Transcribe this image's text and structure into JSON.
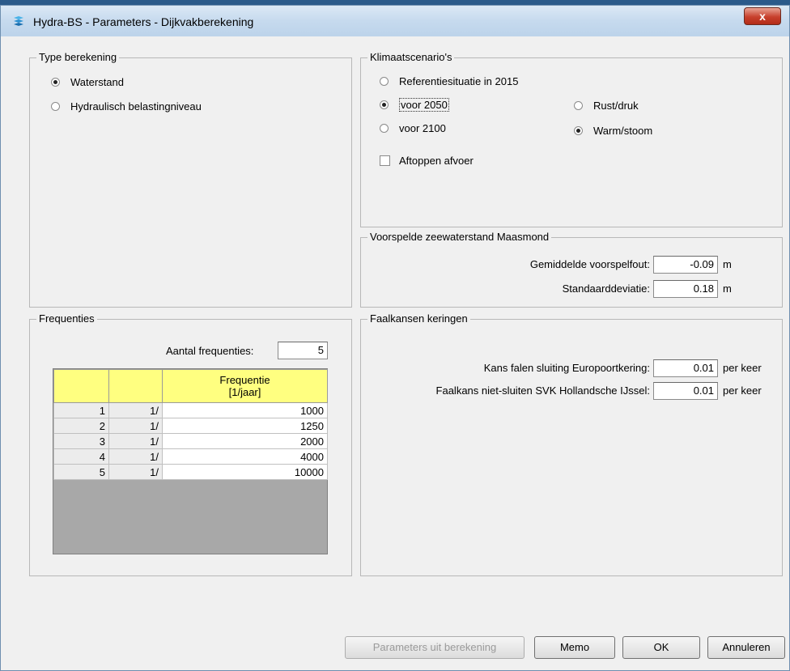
{
  "window": {
    "title": "Hydra-BS - Parameters - Dijkvakberekening",
    "close_label": "x"
  },
  "type_berekening": {
    "title": "Type berekening",
    "options": [
      {
        "label": "Waterstand",
        "checked": true
      },
      {
        "label": "Hydraulisch belastingniveau",
        "checked": false
      }
    ]
  },
  "klimaat": {
    "title": "Klimaatscenario's",
    "options": [
      {
        "label": "Referentiesituatie in 2015",
        "checked": false
      },
      {
        "label": "voor 2050",
        "checked": true
      },
      {
        "label": "voor 2100",
        "checked": false
      }
    ],
    "sub_options": [
      {
        "label": "Rust/druk",
        "checked": false
      },
      {
        "label": "Warm/stoom",
        "checked": true
      }
    ],
    "checkbox_label": "Aftoppen afvoer"
  },
  "voorspelde": {
    "title": "Voorspelde zeewaterstand Maasmond",
    "rows": [
      {
        "label": "Gemiddelde voorspelfout:",
        "value": "-0.09",
        "unit": "m"
      },
      {
        "label": "Standaarddeviatie:",
        "value": "0.18",
        "unit": "m"
      }
    ]
  },
  "frequenties": {
    "title": "Frequenties",
    "count_label": "Aantal frequenties:",
    "count_value": "5",
    "header_line1": "Frequentie",
    "header_line2": "[1/jaar]",
    "rows": [
      {
        "index": "1",
        "prefix": "1/",
        "value": "1000"
      },
      {
        "index": "2",
        "prefix": "1/",
        "value": "1250"
      },
      {
        "index": "3",
        "prefix": "1/",
        "value": "2000"
      },
      {
        "index": "4",
        "prefix": "1/",
        "value": "4000"
      },
      {
        "index": "5",
        "prefix": "1/",
        "value": "10000"
      }
    ]
  },
  "faalkansen": {
    "title": "Faalkansen keringen",
    "rows": [
      {
        "label": "Kans falen sluiting Europoortkering:",
        "value": "0.01",
        "unit": "per keer"
      },
      {
        "label": "Faalkans niet-sluiten SVK Hollandsche IJssel:",
        "value": "0.01",
        "unit": "per keer"
      }
    ]
  },
  "buttons": {
    "params_label": "Parameters uit berekening",
    "memo_label": "Memo",
    "ok_label": "OK",
    "cancel_label": "Annuleren"
  }
}
